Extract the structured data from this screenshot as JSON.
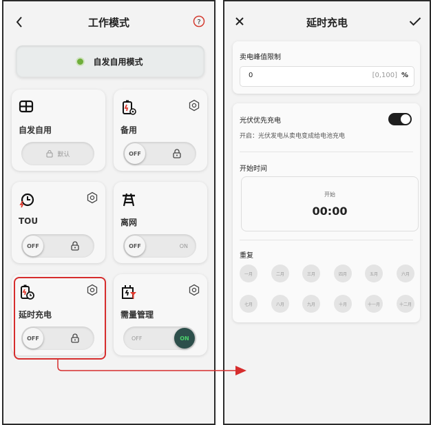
{
  "left_screen": {
    "title": "工作模式",
    "back_icon": "chevron-left-icon",
    "help_icon": "question-circle-icon",
    "active_mode": {
      "label": "自发自用模式",
      "status_color": "#6fae3b"
    },
    "tiles": [
      {
        "name": "自发自用",
        "icon": "grid-icon",
        "control": "default",
        "default_label": "默认",
        "has_settings": false
      },
      {
        "name": "备用",
        "icon": "battery-backup-icon",
        "control": "toggle",
        "state": "OFF",
        "has_settings": true
      },
      {
        "name": "TOU",
        "icon": "clock-bolt-icon",
        "control": "toggle",
        "state": "OFF",
        "has_settings": true
      },
      {
        "name": "离网",
        "icon": "transmission-tower-icon",
        "control": "toggle",
        "state": "OFF",
        "on_label": "ON",
        "has_settings": false
      },
      {
        "name": "延时充电",
        "icon": "battery-clock-icon",
        "control": "toggle",
        "state": "OFF",
        "has_settings": true,
        "highlighted": true
      },
      {
        "name": "需量管理",
        "icon": "demand-management-icon",
        "control": "toggle",
        "state": "ON",
        "off_label": "OFF",
        "has_settings": true
      }
    ],
    "highlight_color": "#d62d2d"
  },
  "right_screen": {
    "title": "延时充电",
    "close_icon": "close-icon",
    "confirm_icon": "check-icon",
    "peak_limit": {
      "label": "卖电峰值限制",
      "value": "0",
      "range": "[0,100]",
      "unit": "%"
    },
    "pv_priority": {
      "label": "光伏优先充电",
      "enabled": true,
      "description": "开启：光伏发电从卖电变成给电池充电"
    },
    "start_time": {
      "section_label": "开始时间",
      "caption": "开始",
      "value": "00:00"
    },
    "repeat": {
      "label": "重复",
      "months": [
        "一月",
        "二月",
        "三月",
        "四月",
        "五月",
        "六月",
        "七月",
        "八月",
        "九月",
        "十月",
        "十一月",
        "十二月"
      ]
    }
  }
}
